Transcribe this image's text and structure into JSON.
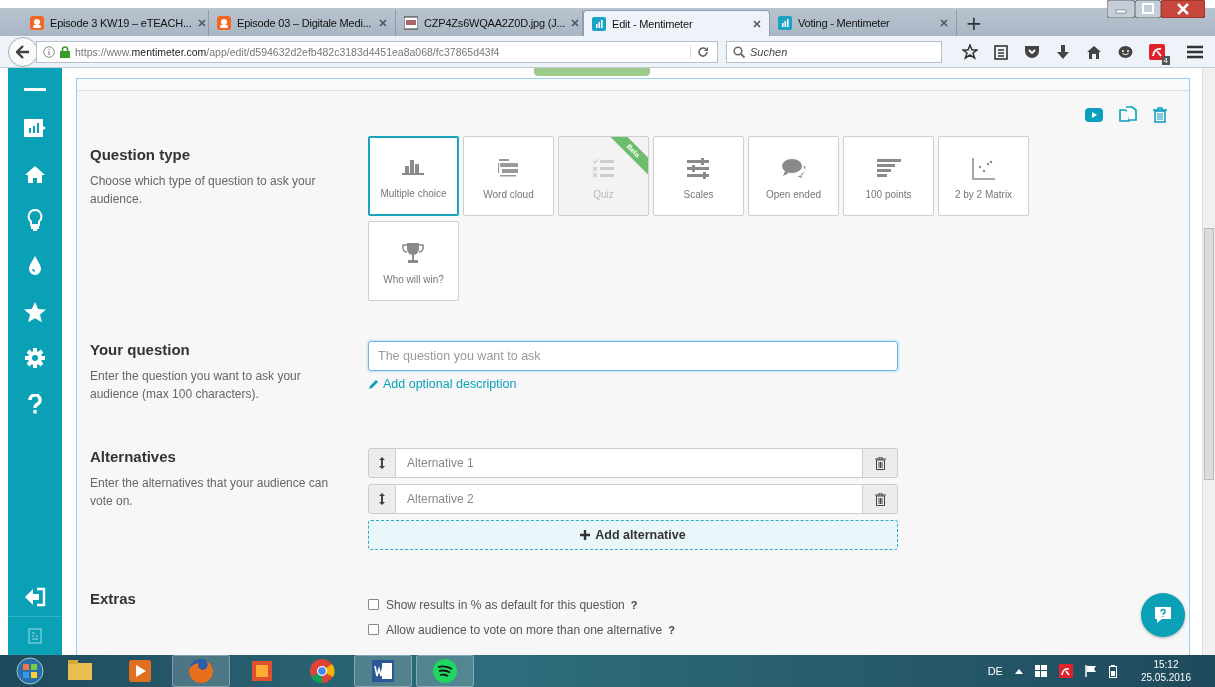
{
  "browser": {
    "tabs": [
      {
        "title": "Episode 3 KW19 – eTEACH...",
        "selected": false,
        "kind": "orange"
      },
      {
        "title": "Episode 03 – Digitale Medi...",
        "selected": false,
        "kind": "orange"
      },
      {
        "title": "CZP4Zs6WQAA2Z0D.jpg (J...",
        "selected": false,
        "kind": "image"
      },
      {
        "title": "Edit - Mentimeter",
        "selected": true,
        "kind": "menti"
      },
      {
        "title": "Voting - Mentimeter",
        "selected": false,
        "kind": "menti"
      }
    ],
    "new_tab": "+",
    "address": "https://www.**mentimeter.com**/app/edit/d594632d2efb482c3183d4451ea8a068/fc37865d43f4",
    "search_placeholder": "Suchen",
    "addon_badge": "4"
  },
  "question_type": {
    "title": "Question type",
    "description": "Choose which type of question to ask your audience.",
    "types": [
      {
        "label": "Multiple choice",
        "kind": "bars",
        "selected": true,
        "disabled": false
      },
      {
        "label": "Word cloud",
        "kind": "cloud",
        "selected": false,
        "disabled": false
      },
      {
        "label": "Quiz",
        "kind": "quiz",
        "selected": false,
        "disabled": true,
        "ribbon": "Beta"
      },
      {
        "label": "Scales",
        "kind": "sliders",
        "selected": false,
        "disabled": false
      },
      {
        "label": "Open ended",
        "kind": "chat",
        "selected": false,
        "disabled": false
      },
      {
        "label": "100 points",
        "kind": "hbars",
        "selected": false,
        "disabled": false
      },
      {
        "label": "2 by 2 Matrix",
        "kind": "matrix",
        "selected": false,
        "disabled": false
      },
      {
        "label": "Who will win?",
        "kind": "trophy",
        "selected": false,
        "disabled": false
      }
    ]
  },
  "your_question": {
    "title": "Your question",
    "description": "Enter the question you want to ask your audience (max 100 characters).",
    "placeholder": "The question you want to ask",
    "focused": true,
    "link": "Add optional description"
  },
  "alternatives": {
    "title": "Alternatives",
    "description": "Enter the alternatives that your audience can vote on.",
    "items": [
      {
        "placeholder": "Alternative 1"
      },
      {
        "placeholder": "Alternative 2"
      }
    ],
    "add_button": "Add alternative"
  },
  "extras": {
    "title": "Extras",
    "options": [
      {
        "label": "Show results in % as default for this question",
        "checked": false,
        "help": "?"
      },
      {
        "label": "Allow audience to vote on more than one alternative",
        "checked": false,
        "help": "?"
      }
    ]
  },
  "taskbar": {
    "language": "DE",
    "time": "15:12",
    "date": "25.05.2016"
  }
}
